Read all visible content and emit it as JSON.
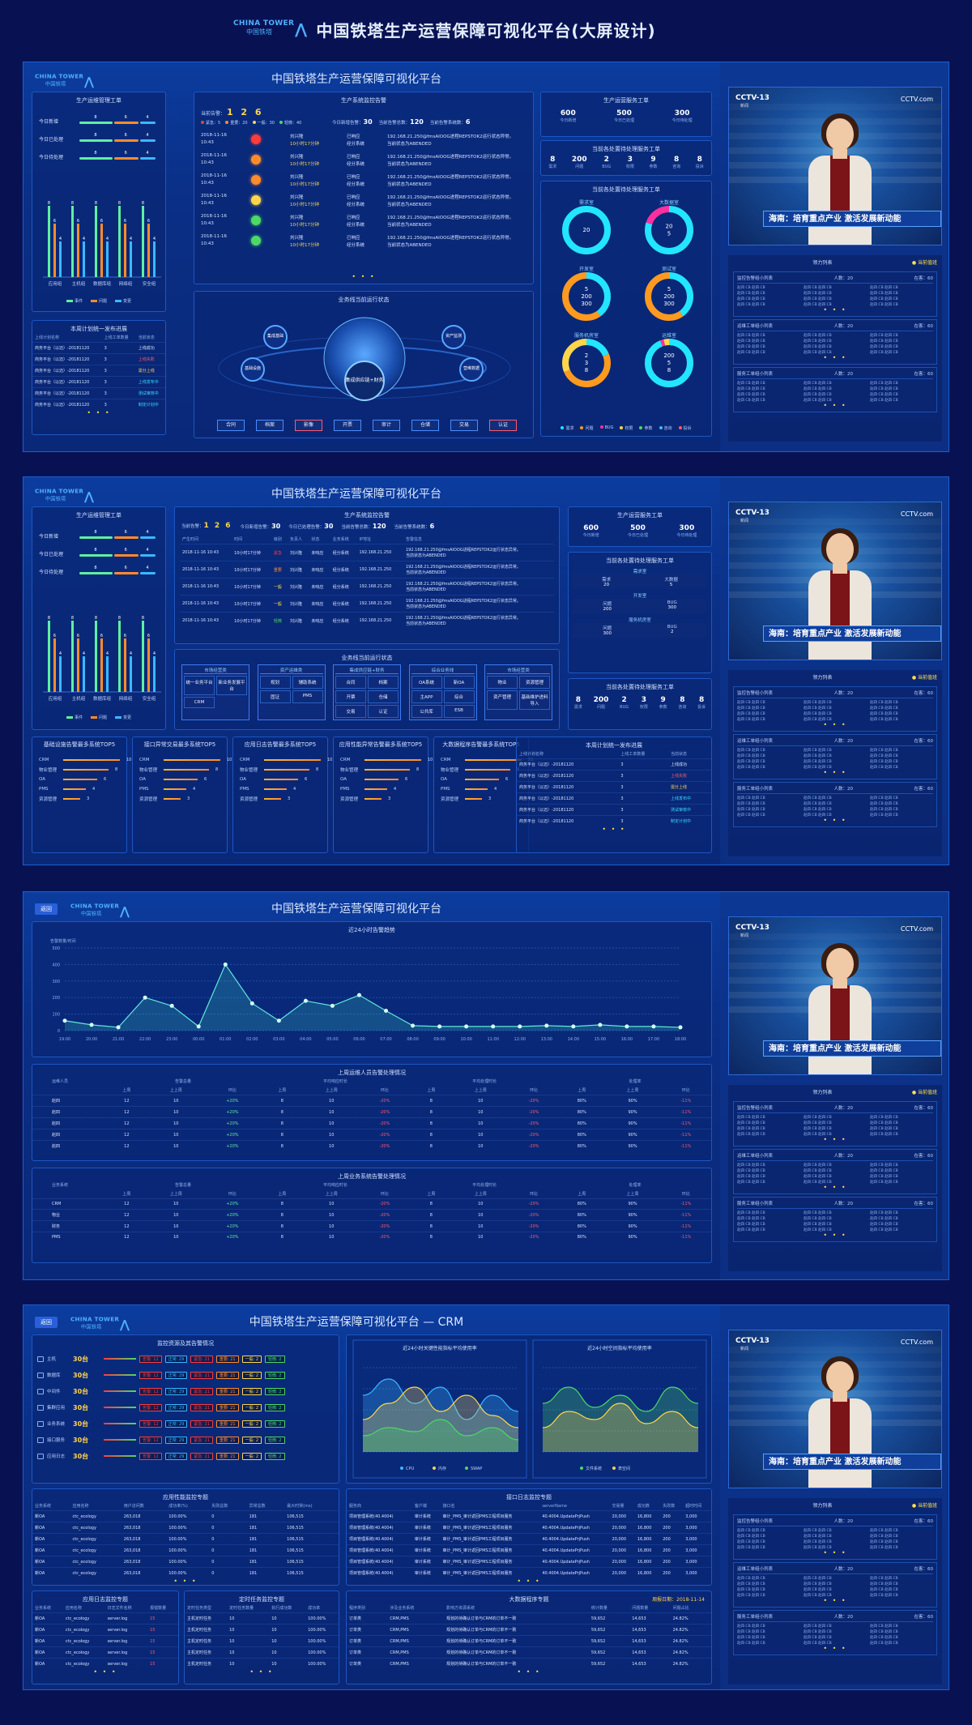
{
  "page_title": "中国铁塔生产运营保障可视化平台(大屏设计)",
  "brand": {
    "en": "CHINA TOWER",
    "cn": "中国铁塔"
  },
  "screen_titles": [
    "中国铁塔生产运营保障可视化平台",
    "中国铁塔生产运营保障可视化平台",
    "中国铁塔生产运营保障可视化平台",
    "中国铁塔生产运营保障可视化平台 — CRM"
  ],
  "back_label": "返回",
  "colors": {
    "bg": "#081253",
    "panel": "#0b3c9e",
    "green": "#5ff0a0",
    "orange": "#ff8c2b",
    "blue": "#3bb8ff",
    "yellow": "#ffd64a",
    "cyan": "#22e6ff"
  },
  "work_orders": {
    "title": "生产运维管理工单",
    "rows": [
      {
        "label": "今日新增",
        "vals": [
          "8",
          "6",
          "4"
        ]
      },
      {
        "label": "今日已处理",
        "vals": [
          "8",
          "6",
          "4"
        ]
      },
      {
        "label": "今日待处理",
        "vals": [
          "8",
          "6",
          "4"
        ]
      }
    ],
    "legend": [
      "事件",
      "问题",
      "变更"
    ]
  },
  "bar_chart": {
    "type": "bar",
    "categories": [
      "应用组",
      "主机组",
      "数据库组",
      "网络组",
      "安全组"
    ],
    "series": [
      {
        "name": "事件",
        "color": "#5ff0a0",
        "values": [
          8,
          8,
          8,
          8,
          8
        ]
      },
      {
        "name": "问题",
        "color": "#ff8c2b",
        "values": [
          6,
          6,
          6,
          6,
          6
        ]
      },
      {
        "name": "变更",
        "color": "#3bb8ff",
        "values": [
          4,
          4,
          4,
          4,
          4
        ]
      }
    ]
  },
  "plan_progress": {
    "title": "本周计划统一发布进展",
    "headers": [
      "上线计划名称",
      "上线工单数量",
      "当前状态"
    ],
    "rows": [
      {
        "name": "商务平台（以迈）-20181120",
        "count": "3",
        "status": "上线成功",
        "color": "green"
      },
      {
        "name": "商务平台（以迈）-20181120",
        "count": "3",
        "status": "上线失败",
        "color": "red"
      },
      {
        "name": "商务平台（以迈）-20181120",
        "count": "3",
        "status": "需分上线",
        "color": "yel"
      },
      {
        "name": "商务平台（以迈）-20181120",
        "count": "3",
        "status": "上线发布中",
        "color": "cy"
      },
      {
        "name": "商务平台（以迈）-20181120",
        "count": "3",
        "status": "测试审核中",
        "color": "cy"
      },
      {
        "name": "商务平台（以迈）-20181120",
        "count": "3",
        "status": "制定计划中",
        "color": "cy"
      }
    ]
  },
  "alarms": {
    "title": "生产系统监控告警",
    "total_label": "当前告警：",
    "total": "1 2 6",
    "today_new_label": "今日新增告警：",
    "today_new": "30",
    "today_done_label": "今日已处理告警：",
    "today_done": "30",
    "today_pending_label": "当前告警总数：",
    "today_pending": "120",
    "sys_label": "当前告警系统数：",
    "sys": "6",
    "legend": [
      "紧急：5",
      "重要：20",
      "一般：30",
      "轻微：40"
    ],
    "headers": [
      "产生时间",
      "时间",
      "级别",
      "负责人",
      "状态",
      "业务系统",
      "IP地址",
      "告警信息"
    ],
    "rows": [
      {
        "date": "2018-11-16",
        "time": "10:43",
        "person": "刘兴隆",
        "dur": "10小时17分钟",
        "state": "已响应",
        "sys": "经分系统",
        "ip": "192.168.21.250",
        "info": "fmsAIOOG进程REPSTOK2运行状态异常。",
        "info2": "当前状态为ABENDED",
        "color": "#ff3b3b"
      },
      {
        "date": "2018-11-16",
        "time": "10:43",
        "person": "刘兴隆",
        "dur": "10小时17分钟",
        "state": "已响应",
        "sys": "经分系统",
        "ip": "192.168.21.250",
        "info": "fmsAIOOG进程REPSTOK2运行状态异常。",
        "info2": "当前状态为ABENDED",
        "color": "#ff8c2b"
      },
      {
        "date": "2018-11-16",
        "time": "10:43",
        "person": "刘兴隆",
        "dur": "10小时17分钟",
        "state": "已响应",
        "sys": "经分系统",
        "ip": "192.168.21.250",
        "info": "fmsAIOOG进程REPSTOK2运行状态异常。",
        "info2": "当前状态为ABENDED",
        "color": "#ff8c2b"
      },
      {
        "date": "2018-11-16",
        "time": "10:43",
        "person": "刘兴隆",
        "dur": "10小时17分钟",
        "state": "已响应",
        "sys": "经分系统",
        "ip": "192.168.21.250",
        "info": "fmsAIOOG进程REPSTOK2运行状态异常。",
        "info2": "当前状态为ABENDED",
        "color": "#ffd64a"
      },
      {
        "date": "2018-11-16",
        "time": "10:43",
        "person": "刘兴隆",
        "dur": "10小时17分钟",
        "state": "已响应",
        "sys": "经分系统",
        "ip": "192.168.21.250",
        "info": "fmsAIOOG进程REPSTOK2运行状态异常。",
        "info2": "当前状态为ABENDED",
        "color": "#4cd964"
      },
      {
        "date": "2018-11-16",
        "time": "10:43",
        "person": "刘兴隆",
        "dur": "10小时17分钟",
        "state": "已响应",
        "sys": "经分系统",
        "ip": "192.168.21.250",
        "info": "fmsAIOOG进程REPSTOK2运行状态异常。",
        "info2": "当前状态为ABENDED",
        "color": "#4cd964"
      }
    ],
    "levels": [
      "紧急",
      "重要",
      "一般",
      "一般",
      "轻微"
    ]
  },
  "business_chain": {
    "title": "业务线当前运行状态",
    "center": "集成供应链+财务",
    "satellites": [
      "集成基础",
      "基础设施",
      "资产监测",
      "营维数据"
    ],
    "buttons": [
      "合同",
      "档案",
      "影像",
      "开票",
      "审计",
      "仓储",
      "交易",
      "认证"
    ]
  },
  "service_orders": {
    "title": "生产运营服务工单",
    "kpis": [
      {
        "v": "600",
        "l": "今日新增"
      },
      {
        "v": "500",
        "l": "今日已处理"
      },
      {
        "v": "300",
        "l": "今日待处理"
      }
    ],
    "pending_title": "当前各处置待处理服务工单",
    "pending": [
      {
        "v": "8",
        "l": "需求"
      },
      {
        "v": "200",
        "l": "问题"
      },
      {
        "v": "2",
        "l": "BUG"
      },
      {
        "v": "3",
        "l": "权限"
      },
      {
        "v": "9",
        "l": "参数"
      },
      {
        "v": "8",
        "l": "咨询"
      },
      {
        "v": "8",
        "l": "投诉"
      }
    ],
    "donut_title": "当前各处置待处理服务工单",
    "donuts": [
      {
        "name": "需求室",
        "values": [
          20
        ],
        "labels": [
          "20"
        ],
        "colors": [
          "#22e6ff"
        ]
      },
      {
        "name": "大数据室",
        "values": [
          20,
          5
        ],
        "labels": [
          "20",
          "5"
        ],
        "colors": [
          "#22e6ff",
          "#ff2fa0"
        ]
      },
      {
        "name": "开发室",
        "values": [
          200,
          300
        ],
        "labels": [
          "5",
          "200",
          "300"
        ],
        "colors": [
          "#22e6ff",
          "#ff9a1f"
        ]
      },
      {
        "name": "测试室",
        "values": [
          200,
          300
        ],
        "labels": [
          "5",
          "200",
          "300"
        ],
        "colors": [
          "#22e6ff",
          "#ff9a1f"
        ]
      },
      {
        "name": "服务机房室",
        "values": [
          3,
          8,
          5
        ],
        "labels": [
          "2",
          "3",
          "8"
        ],
        "colors": [
          "#22e6ff",
          "#ff9a1f",
          "#ffd64a"
        ]
      },
      {
        "name": "运维室",
        "values": [
          200,
          5,
          8
        ],
        "labels": [
          "200",
          "5",
          "8"
        ],
        "colors": [
          "#22e6ff",
          "#ff2fa0",
          "#ffd64a"
        ]
      }
    ],
    "legend": [
      {
        "l": "需求",
        "c": "#22e6ff"
      },
      {
        "l": "问题",
        "c": "#ff9a1f"
      },
      {
        "l": "BUG",
        "c": "#ff2fa0"
      },
      {
        "l": "权限",
        "c": "#ffd64a"
      },
      {
        "l": "参数",
        "c": "#4cd964"
      },
      {
        "l": "咨询",
        "c": "#3bb8ff"
      },
      {
        "l": "投诉",
        "c": "#ff5a6e"
      }
    ]
  },
  "right_panel": {
    "caption": "海南：培育重点产业 激活发展新动能",
    "cctv": "CCTV-13",
    "sub": "新闻",
    "cctv_com": "CCTV.com",
    "list_title": "领力列表",
    "on_duty": "当前值班",
    "blocks": [
      {
        "title": "监控告警组小列表",
        "people": "人数：20",
        "online": "在客：60"
      },
      {
        "title": "运维工单组小列表",
        "people": "人数：20",
        "online": "在客：60"
      },
      {
        "title": "服务工单组小列表",
        "people": "人数：20",
        "online": "在客：60"
      }
    ],
    "cell": "赵四 CB"
  },
  "top5": {
    "titles": [
      "基础设施告警最多系统TOP5",
      "接口异常交易最多系统TOP5",
      "应用日志告警最多系统TOP5",
      "应用性能异常告警最多系统TOP5",
      "大数据程序告警最多系统TOP5"
    ],
    "items": [
      {
        "n": "CRM",
        "v": 10
      },
      {
        "n": "物业管理",
        "v": 8
      },
      {
        "n": "OA",
        "v": 6
      },
      {
        "n": "PMS",
        "v": 4
      },
      {
        "n": "资源管理",
        "v": 3
      }
    ]
  },
  "s2_orders": {
    "title": "当前各处置待处理服务工单",
    "groups": [
      {
        "name": "需求室",
        "a": "需求",
        "av": "20",
        "b": "大数据",
        "bv": "5"
      },
      {
        "name": "开发室",
        "a": "问题",
        "av": "200",
        "b": "BUG",
        "bv": "300"
      },
      {
        "name": "服务机房室",
        "a": "问题",
        "av": "300",
        "b": "BUG",
        "bv": "2"
      }
    ]
  },
  "s2_chain": {
    "title": "业务线当前运行状态",
    "groups": [
      {
        "h": "市场经营类",
        "items": [
          "统一业务平台",
          "新业务发展平台",
          "CRM"
        ]
      },
      {
        "h": "资产运维类",
        "items": [
          "规划",
          "辅助系统",
          "固证",
          "PMS"
        ]
      },
      {
        "h": "集成供应链+财务",
        "items": [
          "合同",
          "档案",
          "开票",
          "仓储",
          "交易",
          "认证"
        ]
      },
      {
        "h": "综合业务线",
        "items": [
          "OA系统",
          "新OA",
          "主APP",
          "综合",
          "公共库",
          "ESB"
        ]
      },
      {
        "h": "市场经营类",
        "items": [
          "物业",
          "资源管理",
          "资产管理",
          "基础维护进料导入"
        ]
      }
    ]
  },
  "trend": {
    "title": "近24小时告警趋势",
    "ylabel": "告警数量/时间",
    "type": "line",
    "x": [
      "19:00",
      "20:00",
      "21:00",
      "22:00",
      "23:00",
      "00:00",
      "01:00",
      "02:00",
      "03:00",
      "04:00",
      "05:00",
      "06:00",
      "07:00",
      "08:00",
      "09:00",
      "10:00",
      "11:00",
      "12:00",
      "13:00",
      "14:00",
      "15:00",
      "16:00",
      "17:00",
      "18:00"
    ],
    "values": [
      60,
      35,
      20,
      200,
      150,
      25,
      400,
      165,
      60,
      180,
      150,
      215,
      120,
      30,
      25,
      25,
      25,
      25,
      30,
      25,
      35,
      25,
      25,
      20
    ],
    "ylim": [
      0,
      500
    ],
    "yticks": [
      "0",
      "100",
      "200",
      "300",
      "400",
      "500"
    ]
  },
  "s3_tables": [
    {
      "title": "上周运维人员告警处理情况",
      "col0": "运维人员",
      "groups": [
        "告警总量",
        "平均响应时长",
        "平均处理时长",
        "处理率"
      ],
      "sub": [
        "上周",
        "上上周",
        "环比"
      ],
      "rows": [
        [
          "赵四",
          "12",
          "10",
          "+20%",
          "8",
          "10",
          "-20%",
          "8",
          "10",
          "-20%",
          "80%",
          "90%",
          "-11%"
        ],
        [
          "赵四",
          "12",
          "10",
          "+20%",
          "8",
          "10",
          "-20%",
          "8",
          "10",
          "-20%",
          "80%",
          "90%",
          "-11%"
        ],
        [
          "赵四",
          "12",
          "10",
          "+20%",
          "8",
          "10",
          "-20%",
          "8",
          "10",
          "-20%",
          "80%",
          "90%",
          "-11%"
        ],
        [
          "赵四",
          "12",
          "10",
          "+20%",
          "8",
          "10",
          "-20%",
          "8",
          "10",
          "-20%",
          "80%",
          "90%",
          "-11%"
        ],
        [
          "赵四",
          "12",
          "10",
          "+20%",
          "8",
          "10",
          "-20%",
          "8",
          "10",
          "-20%",
          "80%",
          "90%",
          "-11%"
        ]
      ]
    },
    {
      "title": "上周业务系统告警处理情况",
      "col0": "业务系统",
      "groups": [
        "告警总量",
        "平均响应时长",
        "平均处理时长",
        "处理率"
      ],
      "sub": [
        "上周",
        "上上周",
        "环比"
      ],
      "rows": [
        [
          "CRM",
          "12",
          "10",
          "+20%",
          "8",
          "10",
          "-20%",
          "8",
          "10",
          "-20%",
          "80%",
          "90%",
          "-11%"
        ],
        [
          "物业",
          "12",
          "10",
          "+20%",
          "8",
          "10",
          "-20%",
          "8",
          "10",
          "-20%",
          "80%",
          "90%",
          "-11%"
        ],
        [
          "财务",
          "12",
          "10",
          "+20%",
          "8",
          "10",
          "-20%",
          "8",
          "10",
          "-20%",
          "80%",
          "90%",
          "-11%"
        ],
        [
          "PMS",
          "12",
          "10",
          "+20%",
          "8",
          "10",
          "-20%",
          "8",
          "10",
          "-20%",
          "80%",
          "90%",
          "-11%"
        ]
      ]
    }
  ],
  "s4_resources": {
    "title": "监控资源及其告警情况",
    "rows": [
      {
        "n": "主机",
        "c": "30台"
      },
      {
        "n": "数据库",
        "c": "30台"
      },
      {
        "n": "中间件",
        "c": "30台"
      },
      {
        "n": "集群应用",
        "c": "30台"
      },
      {
        "n": "业务系统",
        "c": "30台"
      },
      {
        "n": "接口服务",
        "c": "30台"
      },
      {
        "n": "应用日志",
        "c": "30台"
      }
    ],
    "tags": [
      "告警: 12",
      "正常: 29",
      "紧急: 21",
      "重要: 21",
      "一般: 2",
      "轻微: 2"
    ]
  },
  "s4_area": [
    {
      "title": "近24小时关键性能指标平均使用率",
      "legend": [
        "CPU",
        "内存",
        "SWAP"
      ],
      "colors": [
        "#3bb8ff",
        "#ffd64a",
        "#4cd964"
      ]
    },
    {
      "title": "近24小时空间指标平均使用率",
      "legend": [
        "文件系统",
        "表空间"
      ],
      "colors": [
        "#4cd964",
        "#ffd64a"
      ]
    }
  ],
  "s4_perf": {
    "title": "应用性能监控专题",
    "headers": [
      "业务系统",
      "应用名称",
      "用户访问数",
      "成功率(%)",
      "失败总数",
      "异常总数",
      "最大时常(ms)"
    ],
    "rows": [
      [
        "新OA",
        "ctc_ecology",
        "263,018",
        "100.00%",
        "0",
        "181",
        "106,515"
      ],
      [
        "新OA",
        "ctc_ecology",
        "263,018",
        "100.00%",
        "0",
        "181",
        "106,515"
      ],
      [
        "新OA",
        "ctc_ecology",
        "263,018",
        "100.00%",
        "0",
        "181",
        "106,515"
      ],
      [
        "新OA",
        "ctc_ecology",
        "263,018",
        "100.00%",
        "0",
        "181",
        "106,515"
      ],
      [
        "新OA",
        "ctc_ecology",
        "263,018",
        "100.00%",
        "0",
        "181",
        "106,515"
      ],
      [
        "新OA",
        "ctc_ecology",
        "263,018",
        "100.00%",
        "0",
        "181",
        "106,515"
      ]
    ]
  },
  "s4_interface": {
    "title": "接口日志监控专题",
    "headers": [
      "服务商",
      "客户端",
      "接口名",
      "serverName",
      "交易量",
      "成功数",
      "失败数",
      "超时时间"
    ],
    "rows": [
      [
        "项目管理系统(40.4004)",
        "审计系统",
        "审计_PMS_审计返回PMS工程项目服务",
        "40.4004.UpdatePrjPush",
        "20,000",
        "16,800",
        "200",
        "3,000"
      ],
      [
        "项目管理系统(40.4004)",
        "审计系统",
        "审计_PMS_审计返回PMS工程项目服务",
        "40.4004.UpdatePrjPush",
        "20,000",
        "16,800",
        "200",
        "3,000"
      ],
      [
        "项目管理系统(40.4004)",
        "审计系统",
        "审计_PMS_审计返回PMS工程项目服务",
        "40.4004.UpdatePrjPush",
        "20,000",
        "16,800",
        "200",
        "3,000"
      ],
      [
        "项目管理系统(40.4004)",
        "审计系统",
        "审计_PMS_审计返回PMS工程项目服务",
        "40.4004.UpdatePrjPush",
        "20,000",
        "16,800",
        "200",
        "3,000"
      ],
      [
        "项目管理系统(40.4004)",
        "审计系统",
        "审计_PMS_审计返回PMS工程项目服务",
        "40.4004.UpdatePrjPush",
        "20,000",
        "16,800",
        "200",
        "3,000"
      ],
      [
        "项目管理系统(40.4004)",
        "审计系统",
        "审计_PMS_审计返回PMS工程项目服务",
        "40.4004.UpdatePrjPush",
        "20,000",
        "16,800",
        "200",
        "3,000"
      ]
    ]
  },
  "s4_log": {
    "title": "应用日志监控专题",
    "headers": [
      "业务系统",
      "应用名称",
      "日志文件名称",
      "报错数量"
    ],
    "rows": [
      [
        "新OA",
        "ctc_ecology",
        "server.log",
        "15"
      ],
      [
        "新OA",
        "ctc_ecology",
        "server.log",
        "15"
      ],
      [
        "新OA",
        "ctc_ecology",
        "server.log",
        "15"
      ],
      [
        "新OA",
        "ctc_ecology",
        "server.log",
        "15"
      ],
      [
        "新OA",
        "ctc_ecology",
        "server.log",
        "15"
      ]
    ]
  },
  "s4_task": {
    "title": "定时任务监控专题",
    "headers": [
      "定时任务类型",
      "定时任务数量",
      "执行成功数",
      "成功率"
    ],
    "rows": [
      [
        "主机定时任务",
        "10",
        "10",
        "100.00%"
      ],
      [
        "主机定时任务",
        "10",
        "10",
        "100.00%"
      ],
      [
        "主机定时任务",
        "10",
        "10",
        "100.00%"
      ],
      [
        "主机定时任务",
        "10",
        "10",
        "100.00%"
      ],
      [
        "主机定时任务",
        "10",
        "10",
        "100.00%"
      ]
    ]
  },
  "s4_bigdata": {
    "title": "大数据程序专题",
    "period": "周报日期：2018-11-14",
    "headers": [
      "程序类别",
      "涉及业务系统",
      "影响方资源系统",
      "统计数量",
      "问题数量",
      "问题占比"
    ],
    "rows": [
      [
        "订单类",
        "CRM,PMS",
        "规划的待确认订单与CRM的订单不一致",
        "59,652",
        "14,653",
        "24.82%"
      ],
      [
        "订单类",
        "CRM,PMS",
        "规划的待确认订单与CRM的订单不一致",
        "59,652",
        "14,653",
        "24.82%"
      ],
      [
        "订单类",
        "CRM,PMS",
        "规划的待确认订单与CRM的订单不一致",
        "59,652",
        "14,653",
        "24.82%"
      ],
      [
        "订单类",
        "CRM,PMS",
        "规划的待确认订单与CRM的订单不一致",
        "59,652",
        "14,653",
        "24.82%"
      ],
      [
        "订单类",
        "CRM,PMS",
        "规划的待确认订单与CRM的订单不一致",
        "59,652",
        "14,653",
        "24.82%"
      ]
    ]
  }
}
